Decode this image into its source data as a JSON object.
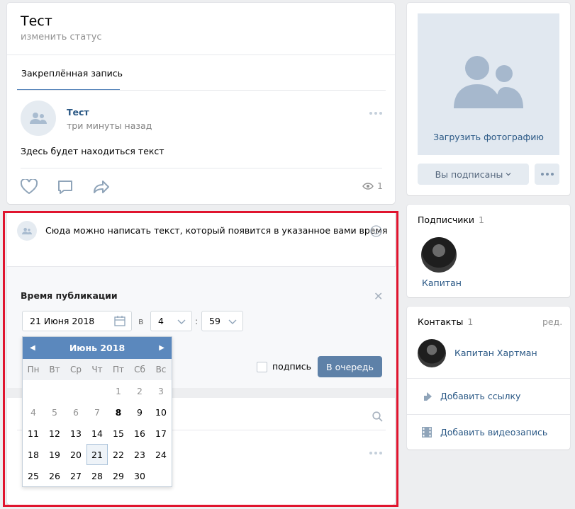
{
  "header": {
    "title": "Тест",
    "status": "изменить статус"
  },
  "pinned": {
    "tab": "Закреплённая запись",
    "author": "Тест",
    "time": "три минуты назад",
    "text": "Здесь будет находиться текст",
    "views": "1"
  },
  "composer": {
    "text": "Сюда можно написать текст, который появится в указанное вами время",
    "pub_label": "Время публикации",
    "date_value": "21 Июня 2018",
    "in_label": "в",
    "hour_value": "4",
    "colon": ":",
    "minute_value": "59",
    "signature_label": "подпись",
    "queue_button": "В очередь"
  },
  "calendar": {
    "month_label": "Июнь 2018",
    "weekdays": [
      "Пн",
      "Вт",
      "Ср",
      "Чт",
      "Пт",
      "Сб",
      "Вс"
    ],
    "weeks": [
      [
        "",
        "",
        "",
        "",
        "1",
        "2",
        "3"
      ],
      [
        "4",
        "5",
        "6",
        "7",
        "8",
        "9",
        "10"
      ],
      [
        "11",
        "12",
        "13",
        "14",
        "15",
        "16",
        "17"
      ],
      [
        "18",
        "19",
        "20",
        "21",
        "22",
        "23",
        "24"
      ],
      [
        "25",
        "26",
        "27",
        "28",
        "29",
        "30",
        ""
      ]
    ],
    "past_days": [
      "1",
      "2",
      "3",
      "4",
      "5",
      "6",
      "7"
    ],
    "today": "8",
    "selected": "21"
  },
  "sidebar": {
    "upload_photo": "Загрузить фотографию",
    "subscribed_button": "Вы подписаны",
    "subscribers_title": "Подписчики",
    "subscribers_count": "1",
    "subscriber_name": "Капитан",
    "contacts_title": "Контакты",
    "contacts_count": "1",
    "edit_link": "ред.",
    "contact_name": "Капитан Хартман",
    "add_link": "Добавить ссылку",
    "add_video": "Добавить видеозапись"
  },
  "colors": {
    "accent": "#5181b8",
    "highlight": "#e0142e",
    "button": "#5e81a8"
  }
}
